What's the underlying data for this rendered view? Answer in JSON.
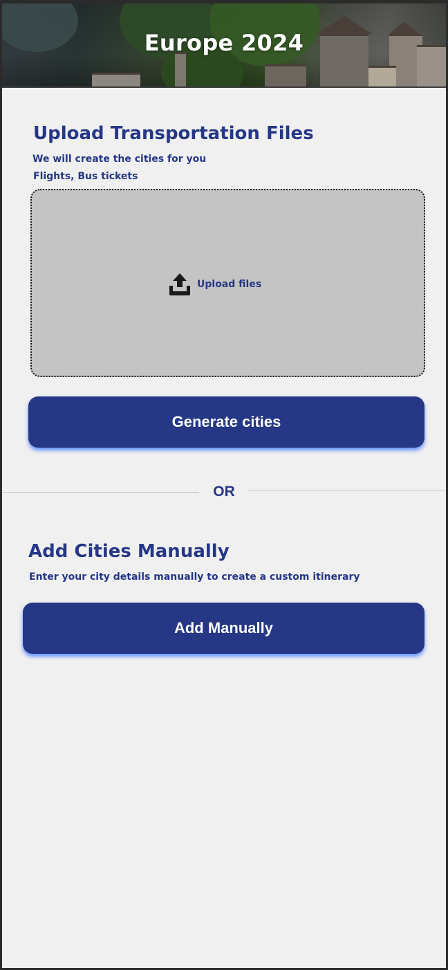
{
  "header": {
    "title": "Europe 2024"
  },
  "upload_section": {
    "title": "Upload Transportation Files",
    "subtitle_line1": "We will create the cities for you",
    "subtitle_line2": "Flights, Bus tickets",
    "dropzone": {
      "icon": "upload-icon",
      "label": "Upload files"
    },
    "generate_button_label": "Generate cities"
  },
  "divider": {
    "label": "OR"
  },
  "manual_section": {
    "title": "Add Cities Manually",
    "subtitle": "Enter your city details manually to create a custom itinerary",
    "add_button_label": "Add Manually"
  },
  "colors": {
    "primary": "#253785",
    "background": "#f0f0f0",
    "dropzone": "#c4c4c4",
    "button_glow": "#2b6bff"
  }
}
